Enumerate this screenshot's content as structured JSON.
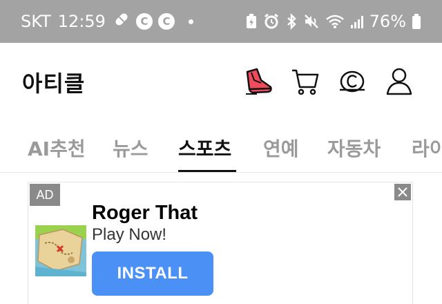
{
  "status_bar": {
    "carrier": "SKT",
    "time": "12:59",
    "notif_badges": [
      "C",
      "C"
    ],
    "battery": "76%",
    "icons": [
      "pill-icon",
      "battery-saver-icon",
      "alarm-icon",
      "bluetooth-icon",
      "mute-icon",
      "wifi-icon",
      "signal-icon",
      "battery-icon"
    ]
  },
  "header": {
    "title": "아티클",
    "icons": [
      "sneaker-icon",
      "cart-icon",
      "copyright-coin-icon",
      "profile-icon"
    ]
  },
  "tabs": [
    {
      "label": "AI추천",
      "active": false
    },
    {
      "label": "뉴스",
      "active": false
    },
    {
      "label": "스포츠",
      "active": true
    },
    {
      "label": "연예",
      "active": false
    },
    {
      "label": "자동차",
      "active": false
    },
    {
      "label": "라이",
      "active": false
    }
  ],
  "ad": {
    "badge": "AD",
    "title": "Roger That",
    "subtitle": "Play Now!",
    "cta": "INSTALL",
    "close_icon": "close-icon",
    "cta_color": "#4a90f5"
  }
}
